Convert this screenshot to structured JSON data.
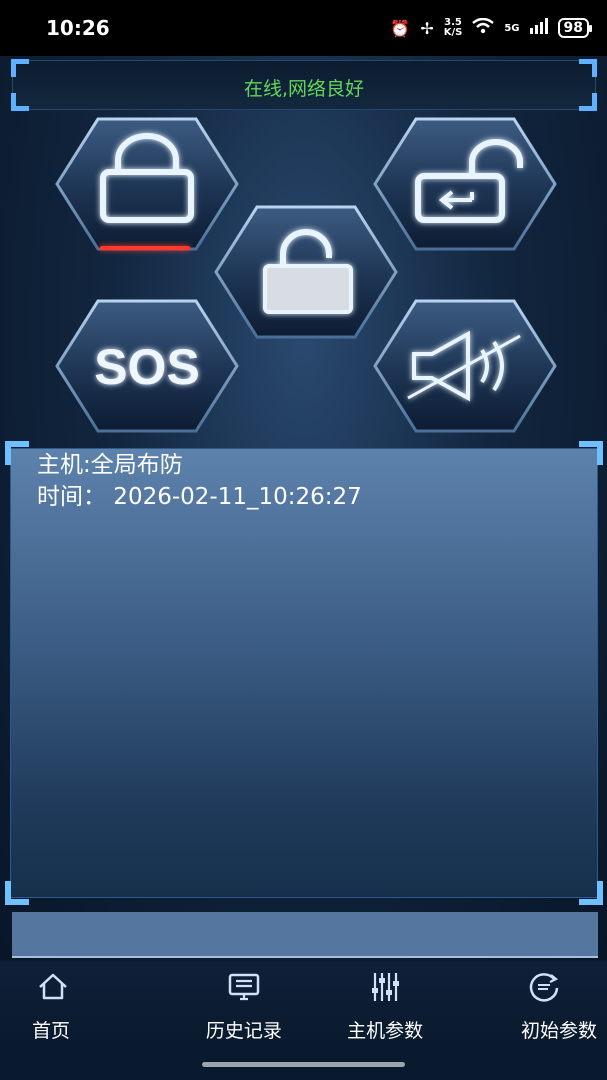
{
  "status_bar": {
    "time": "10:26",
    "speed_top": "3.5",
    "speed_bottom": "K/S",
    "network": "5G",
    "battery": "98"
  },
  "header": {
    "status": "在线,网络良好"
  },
  "controls": {
    "lock_text": "",
    "sos_label": "SOS"
  },
  "info": {
    "host_status": "主机:全局布防",
    "time_line": "时间：  2026-02-11_10:26:27"
  },
  "nav": {
    "items": [
      {
        "label": "首页",
        "icon": "home-icon"
      },
      {
        "label": "历史记录",
        "icon": "monitor-icon"
      },
      {
        "label": "主机参数",
        "icon": "sliders-icon"
      },
      {
        "label": "初始参数",
        "icon": "reset-icon"
      }
    ]
  },
  "colors": {
    "online_green": "#63d65a",
    "accent_blue": "#5fb0ff",
    "alert_red": "#ff3a2a"
  }
}
